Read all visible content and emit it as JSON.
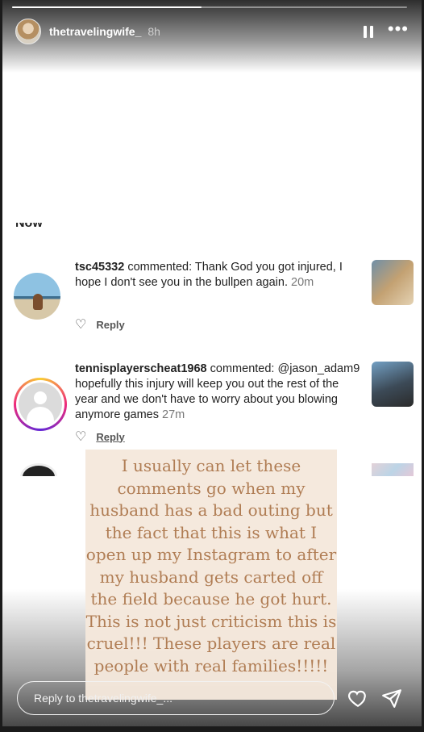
{
  "story": {
    "username": "thetravelingwife_",
    "time": "8h",
    "progress": 0.48
  },
  "comments": [
    {
      "author": "tsc45332",
      "verb": "commented:",
      "text": "Thank God you got injured, I hope I don't see you in the bullpen again.",
      "ago": "20m",
      "reply_label": "Reply"
    },
    {
      "author": "tennisplayerscheat1968",
      "verb": "commented:",
      "text": "@jason_adam9  hopefully this injury will keep you out the rest of the year and we don't have to worry about you blowing anymore games",
      "ago": "27m",
      "reply_label": "Reply"
    }
  ],
  "overlay": {
    "text": "I usually can let these comments go when my husband has a bad outing but the fact that this is what I open up my Instagram to after my husband gets carted off the field because he got hurt. This is not just criticism this is cruel!!! These players are real people with real families!!!!!",
    "color": "#b07d54",
    "background": "#f5e8dc"
  },
  "reply": {
    "placeholder": "Reply to thetravelingwife_..."
  },
  "icons": {
    "pause": "pause-icon",
    "more": "more-icon",
    "heart": "heart-icon",
    "send": "send-icon"
  }
}
